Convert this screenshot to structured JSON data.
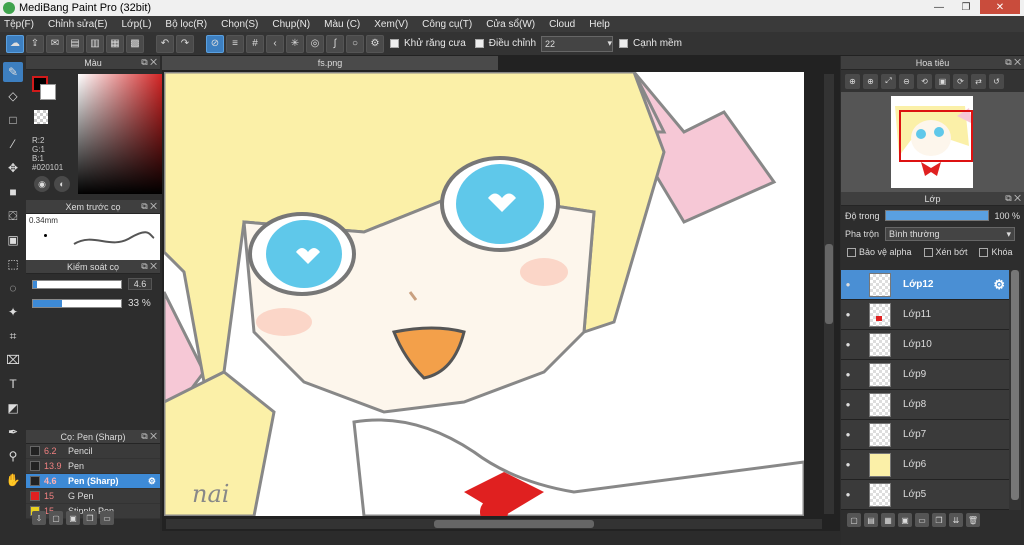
{
  "window": {
    "title": "MediBang Paint Pro (32bit)",
    "min": "—",
    "max": "❐",
    "close": "✕"
  },
  "menu": [
    "Tệp(F)",
    "Chỉnh sửa(E)",
    "Lớp(L)",
    "Bộ lọc(R)",
    "Chọn(S)",
    "Chụp(N)",
    "Màu (C)",
    "Xem(V)",
    "Công cụ(T)",
    "Cửa sổ(W)",
    "Cloud",
    "Help"
  ],
  "toolbar": {
    "antialias_label": "Khử răng cưa",
    "adjust_label": "Điều chỉnh",
    "adjust_value": "22",
    "edge_label": "Cạnh mềm"
  },
  "color_panel": {
    "title": "Màu",
    "r": "R:2",
    "g": "G:1",
    "b": "B:1",
    "hex": "#020101",
    "fg_color": "#020101",
    "accent": "#3d8ad6"
  },
  "brush_preview": {
    "title": "Xem trước cọ",
    "size": "0.34mm"
  },
  "brush_control": {
    "title": "Kiểm soát cọ",
    "size_value": "4.6",
    "opacity_value": "33 %"
  },
  "brushes": {
    "title": "Cọ: Pen (Sharp)",
    "items": [
      {
        "size": "6.2",
        "name": "Pencil",
        "color": "#222222"
      },
      {
        "size": "13.9",
        "name": "Pen",
        "color": "#222222"
      },
      {
        "size": "4.6",
        "name": "Pen (Sharp)",
        "color": "#222222"
      },
      {
        "size": "15",
        "name": "G Pen",
        "color": "#e02020"
      },
      {
        "size": "15",
        "name": "Stipple Pen",
        "color": "#e8d020"
      }
    ]
  },
  "document": {
    "tab": "fs.png",
    "signature": "nai"
  },
  "navigator": {
    "title": "Hoa tiêu"
  },
  "layers_panel": {
    "title": "Lớp",
    "opacity_label": "Độ trong",
    "opacity_value": "100 %",
    "blend_label": "Pha trộn",
    "blend_value": "Bình thường",
    "protect_alpha": "Bảo vệ alpha",
    "clipping": "Xén bớt",
    "lock": "Khóa",
    "layers": [
      "Lớp12",
      "Lớp11",
      "Lớp10",
      "Lớp9",
      "Lớp8",
      "Lớp7",
      "Lớp6",
      "Lớp5"
    ]
  }
}
